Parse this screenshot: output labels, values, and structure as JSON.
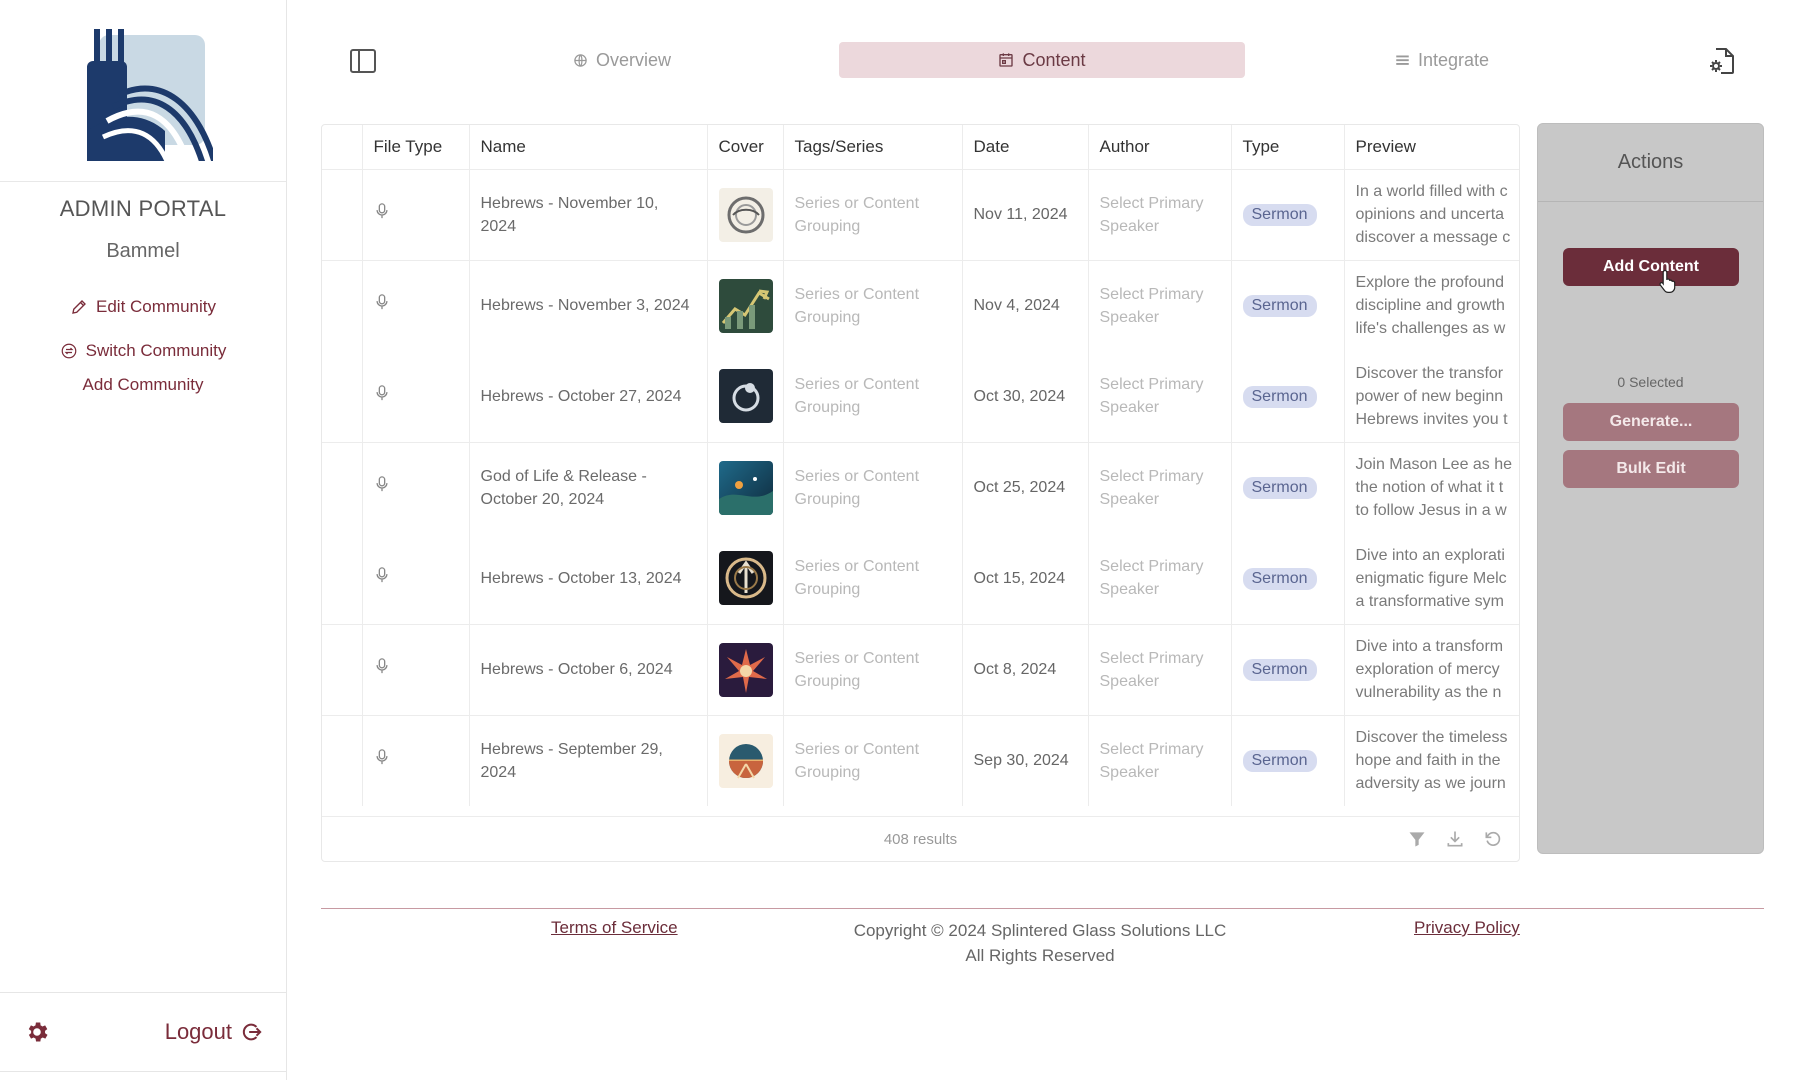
{
  "sidebar": {
    "portal_title": "ADMIN PORTAL",
    "community_name": "Bammel",
    "links": {
      "edit_community": "Edit Community",
      "switch_community": "Switch Community",
      "add_community": "Add Community"
    },
    "logout_label": "Logout"
  },
  "topnav": {
    "tabs": {
      "overview": "Overview",
      "content": "Content",
      "integrate": "Integrate"
    },
    "active_tab": "Content"
  },
  "table": {
    "columns": [
      "File Type",
      "Name",
      "Cover",
      "Tags/Series",
      "Date",
      "Author",
      "Type",
      "Preview"
    ],
    "rows": [
      {
        "name": "Hebrews - November 10, 2024",
        "tags": "Series or Content Grouping",
        "date": "Nov 11, 2024",
        "author": "Select Primary Speaker",
        "type": "Sermon",
        "preview": [
          "In a world filled with c",
          "opinions and uncerta",
          "discover a message c"
        ]
      },
      {
        "name": "Hebrews - November 3, 2024",
        "tags": "Series or Content Grouping",
        "date": "Nov 4, 2024",
        "author": "Select Primary Speaker",
        "type": "Sermon",
        "preview": [
          "Explore the profound",
          "discipline and growth",
          "life's challenges as w"
        ]
      },
      {
        "name": "Hebrews - October 27, 2024",
        "tags": "Series or Content Grouping",
        "date": "Oct 30, 2024",
        "author": "Select Primary Speaker",
        "type": "Sermon",
        "preview": [
          "Discover the transfor",
          "power of new beginn",
          "Hebrews invites you t"
        ]
      },
      {
        "name": "God of Life & Release - October 20, 2024",
        "tags": "Series or Content Grouping",
        "date": "Oct 25, 2024",
        "author": "Select Primary Speaker",
        "type": "Sermon",
        "preview": [
          "Join Mason Lee as he",
          "the notion of what it t",
          "to follow Jesus in a w"
        ]
      },
      {
        "name": "Hebrews - October 13, 2024",
        "tags": "Series or Content Grouping",
        "date": "Oct 15, 2024",
        "author": "Select Primary Speaker",
        "type": "Sermon",
        "preview": [
          "Dive into an explorati",
          "enigmatic figure Melc",
          "a transformative sym"
        ]
      },
      {
        "name": "Hebrews - October 6, 2024",
        "tags": "Series or Content Grouping",
        "date": "Oct 8, 2024",
        "author": "Select Primary Speaker",
        "type": "Sermon",
        "preview": [
          "Dive into a transform",
          "exploration of mercy",
          "vulnerability as the n"
        ]
      },
      {
        "name": "Hebrews - September 29, 2024",
        "tags": "Series or Content Grouping",
        "date": "Sep 30, 2024",
        "author": "Select Primary Speaker",
        "type": "Sermon",
        "preview": [
          "Discover the timeless",
          "hope and faith in the",
          "adversity as we journ"
        ]
      }
    ],
    "results_text": "408 results"
  },
  "actions": {
    "title": "Actions",
    "add_content": "Add Content",
    "selected_count": "0 Selected",
    "generate": "Generate...",
    "bulk_edit": "Bulk Edit"
  },
  "footer": {
    "terms": "Terms of Service",
    "copyright": "Copyright © 2024 Splintered Glass Solutions LLC",
    "rights": "All Rights Reserved",
    "privacy": "Privacy Policy"
  },
  "colors": {
    "brand": "#6b2d3a",
    "active_tab_bg": "#ecd8dc",
    "badge_bg": "#d7dcf0",
    "actions_panel_bg": "#c8c8c8",
    "logo_navy": "#1d3a6b",
    "logo_light": "#c9d9e4"
  },
  "icons": {
    "edit": "pencil-icon",
    "switch": "switch-arrows-icon",
    "settings": "gear-icon",
    "logout": "logout-icon",
    "panel": "sidebar-toggle-icon",
    "overview": "globe-icon",
    "content": "calendar-icon",
    "integrate": "list-icon",
    "page_settings": "file-gear-icon",
    "file_type": "microphone-icon",
    "filter": "filter-icon",
    "download": "download-icon",
    "refresh": "refresh-icon"
  }
}
